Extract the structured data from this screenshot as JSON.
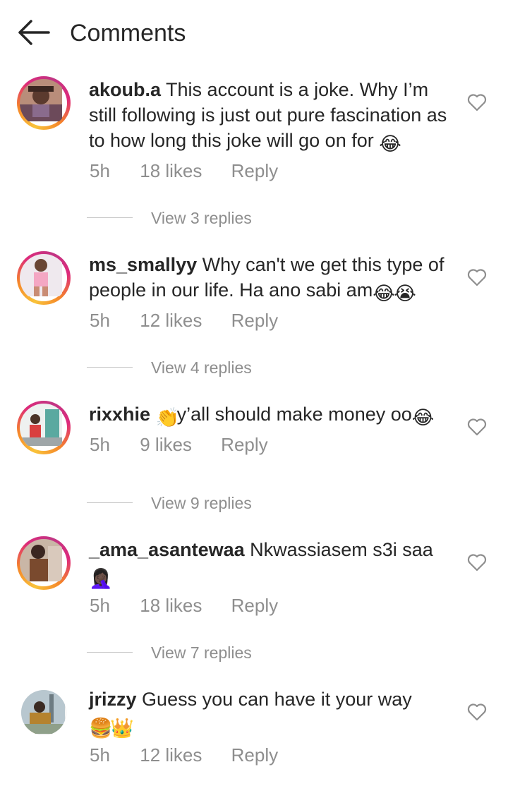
{
  "header": {
    "title": "Comments",
    "back_icon": "arrow-left-icon"
  },
  "colors": {
    "text": "#262626",
    "muted": "#8e8e8e",
    "story_ring": [
      "#f9c33a",
      "#f58529",
      "#dd2a7b",
      "#c13584"
    ]
  },
  "comments": [
    {
      "username": "akoub.a",
      "text": "This account is a joke. Why I’m still following is just out pure fascination as to how long this joke will go on for",
      "emojis": [
        "😂"
      ],
      "time": "5h",
      "likes": "18 likes",
      "reply_label": "Reply",
      "view_replies": "View 3 replies"
    },
    {
      "username": "ms_smallyy",
      "text": "Why can't we get this type of people in our life. Ha ano sabi am",
      "emojis": [
        "😂",
        "😭"
      ],
      "time": "5h",
      "likes": "12 likes",
      "reply_label": "Reply",
      "view_replies": "View 4 replies"
    },
    {
      "username": "rixxhie",
      "text_pre": "👏",
      "text": "y’all should make money oo",
      "emojis": [
        "😂"
      ],
      "time": "5h",
      "likes": "9 likes",
      "reply_label": "Reply",
      "view_replies": "View 9 replies"
    },
    {
      "username": "_ama_asantewaa",
      "text": "Nkwassiasem s3i saa",
      "emojis": [
        "🤦🏿‍♀️"
      ],
      "time": "5h",
      "likes": "18 likes",
      "reply_label": "Reply",
      "view_replies": "View 7 replies"
    },
    {
      "username": "jrizzy",
      "text": "Guess you can have it your way",
      "emojis": [
        "🍔",
        "👑"
      ],
      "time": "5h",
      "likes": "12 likes",
      "reply_label": "Reply"
    }
  ]
}
